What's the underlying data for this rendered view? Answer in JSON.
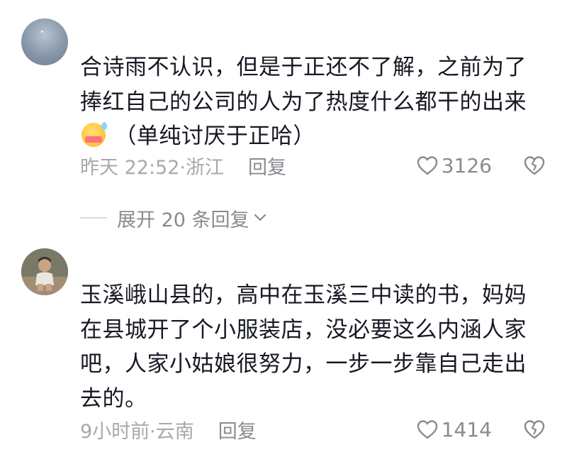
{
  "comments": [
    {
      "text_before_emoji": "合诗雨不认识，但是于正还不了解，之前为了捧红自己的公司的人为了热度什么都干的出来",
      "emoji": "shy-laugh-emoji",
      "text_after_emoji": " （单纯讨厌于正哈）",
      "time_location": "昨天 22:52·浙江",
      "reply_label": "回复",
      "likes": "3126"
    },
    {
      "text": "玉溪峨山县的，高中在玉溪三中读的书，妈妈在县城开了个小服装店，没必要这么内涵人家吧，人家小姑娘很努力，一步一步靠自己走出去的。",
      "time_location": "9小时前·云南",
      "reply_label": "回复",
      "likes": "1414"
    }
  ],
  "expand_replies": "展开 20 条回复",
  "icons": {
    "like": "heart-outline-icon",
    "dislike": "broken-heart-icon",
    "expand": "chevron-down-icon"
  },
  "colors": {
    "text": "#161823",
    "meta": "#a7a9ad",
    "secondary": "#8a8b91"
  }
}
